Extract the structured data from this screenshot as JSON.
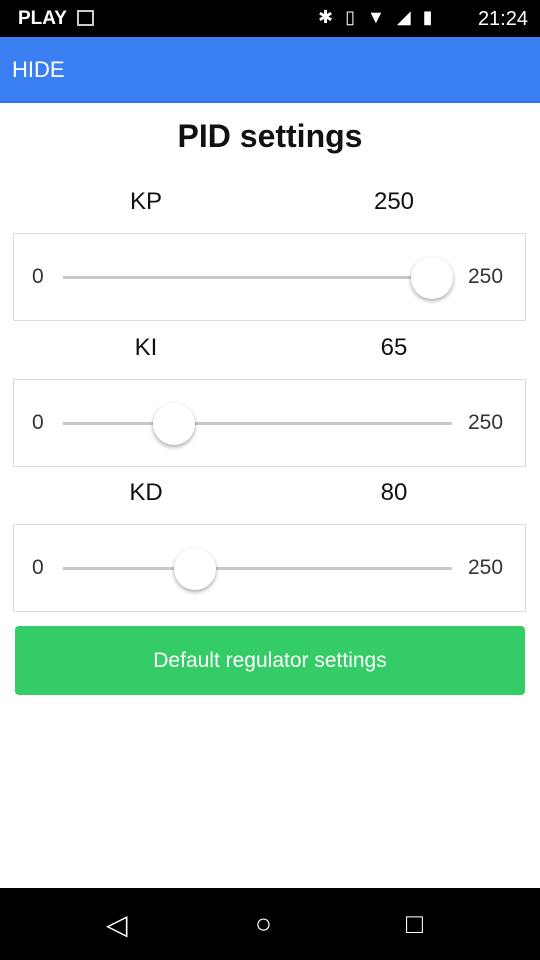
{
  "status_bar": {
    "carrier": "PLAY",
    "time": "21:24"
  },
  "app_bar": {
    "hide_label": "HIDE"
  },
  "page_title": "PID settings",
  "sliders": [
    {
      "name": "KP",
      "value": 250,
      "value_text": "250",
      "min": "0",
      "max": "250",
      "min_value": 0,
      "max_value": 250
    },
    {
      "name": "KI",
      "value": 65,
      "value_text": "65",
      "min": "0",
      "max": "250",
      "min_value": 0,
      "max_value": 250
    },
    {
      "name": "KD",
      "value": 80,
      "value_text": "80",
      "min": "0",
      "max": "250",
      "min_value": 0,
      "max_value": 250
    }
  ],
  "default_button": "Default regulator settings",
  "colors": {
    "app_bar": "#3a7ff2",
    "button": "#34cc66"
  }
}
